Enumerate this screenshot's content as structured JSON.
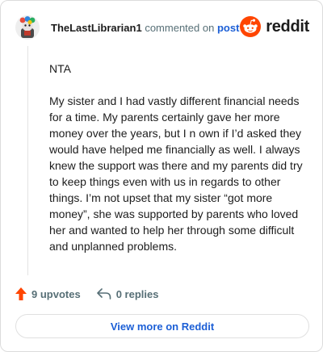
{
  "header": {
    "username": "TheLastLibrarian1",
    "commented_text": "commented on",
    "post_link": "post",
    "brand": "reddit"
  },
  "comment": {
    "paragraphs": [
      "NTA",
      "My sister and I had vastly different financial needs for a time. My parents certainly gave her more money over the years, but I n own if I’d asked they would have helped me financially as well. I always knew the support was there and my parents did try to keep things even with us in regards to other things. I’m not upset that my sister “got more money”, she was supported by parents who loved her and wanted to help her through some difficult and unplanned problems."
    ]
  },
  "actions": {
    "upvotes": "9 upvotes",
    "replies": "0 replies"
  },
  "footer": {
    "view_more": "View more on Reddit"
  },
  "colors": {
    "accent": "#ff4500",
    "link": "#1c5fd6",
    "muted": "#576f76"
  },
  "icons": {
    "upvote": "arrow-up-icon",
    "reply": "reply-arrow-icon",
    "brand": "reddit-alien-icon"
  }
}
